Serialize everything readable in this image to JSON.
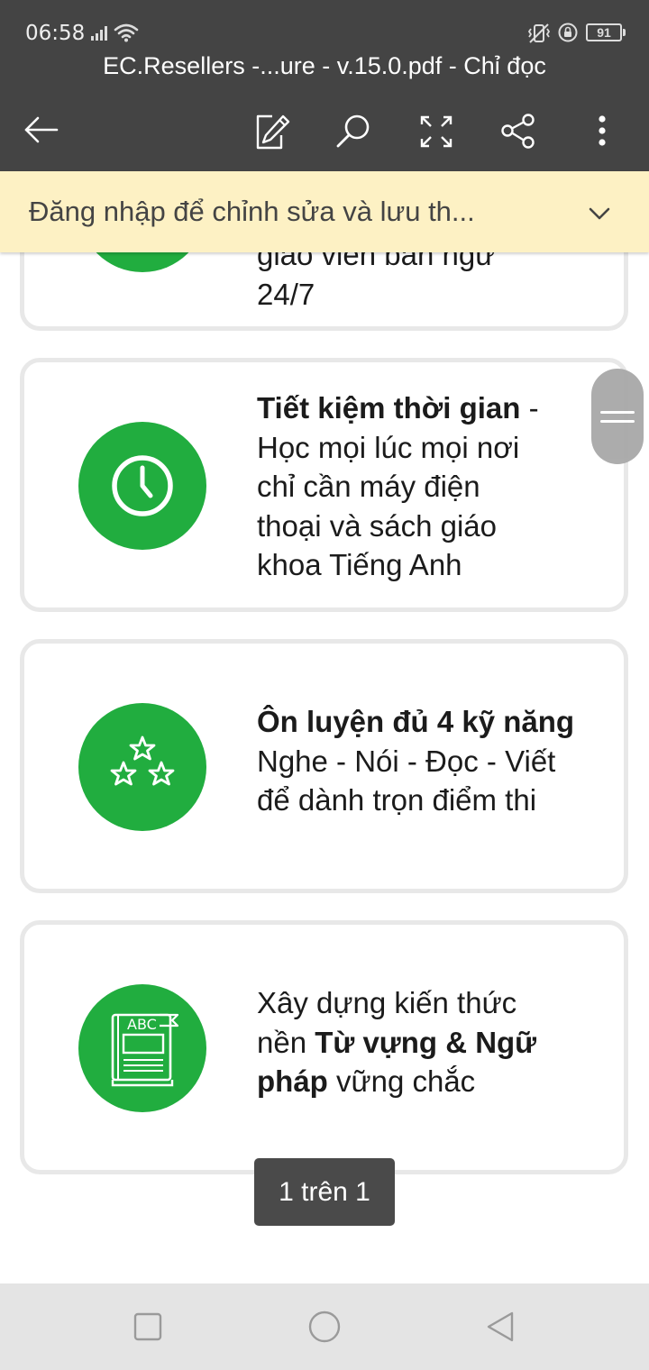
{
  "status_bar": {
    "time": "06:58",
    "battery": "91"
  },
  "toolbar": {
    "document_title": "EC.Resellers -...ure - v.15.0.pdf - Chỉ đọc",
    "icons": [
      "back-arrow-icon",
      "edit-icon",
      "search-icon",
      "fullscreen-icon",
      "share-icon",
      "more-vert-icon"
    ]
  },
  "banner": {
    "text": "Đăng nhập để chỉnh sửa và lưu th...",
    "icon": "chevron-down-icon"
  },
  "cards": [
    {
      "id": "teacher",
      "icon": "clipped-circle",
      "line_partial": "giáo viên bản ngữ",
      "line": "24/7"
    },
    {
      "id": "time",
      "icon": "clock-icon",
      "title": "Tiết kiệm thời gian",
      "title_suffix": " -",
      "lines": [
        "Học mọi lúc mọi nơi",
        "chỉ cần máy điện",
        "thoại và sách giáo",
        "khoa Tiếng Anh"
      ]
    },
    {
      "id": "skills",
      "icon": "stars-icon",
      "title": "Ôn luyện đủ 4 kỹ năng",
      "lines": [
        "Nghe - Nói - Đọc - Viết",
        "để dành trọn điểm thi"
      ]
    },
    {
      "id": "vocab",
      "icon": "abc-book-icon",
      "line1": "Xây dựng kiến thức",
      "line2_prefix": "nền ",
      "line2_bold": "Từ vựng & Ngữ",
      "line3_bold": "pháp",
      "line3_suffix": " vững chắc",
      "book_label": "ABC"
    }
  ],
  "page_indicator": "1 trên 1",
  "colors": {
    "toolbar": "#444444",
    "banner": "#fdf1c4",
    "accent_green": "#21ad3f",
    "card_border": "#e8e8e8",
    "nav_bar": "#e4e4e4"
  }
}
